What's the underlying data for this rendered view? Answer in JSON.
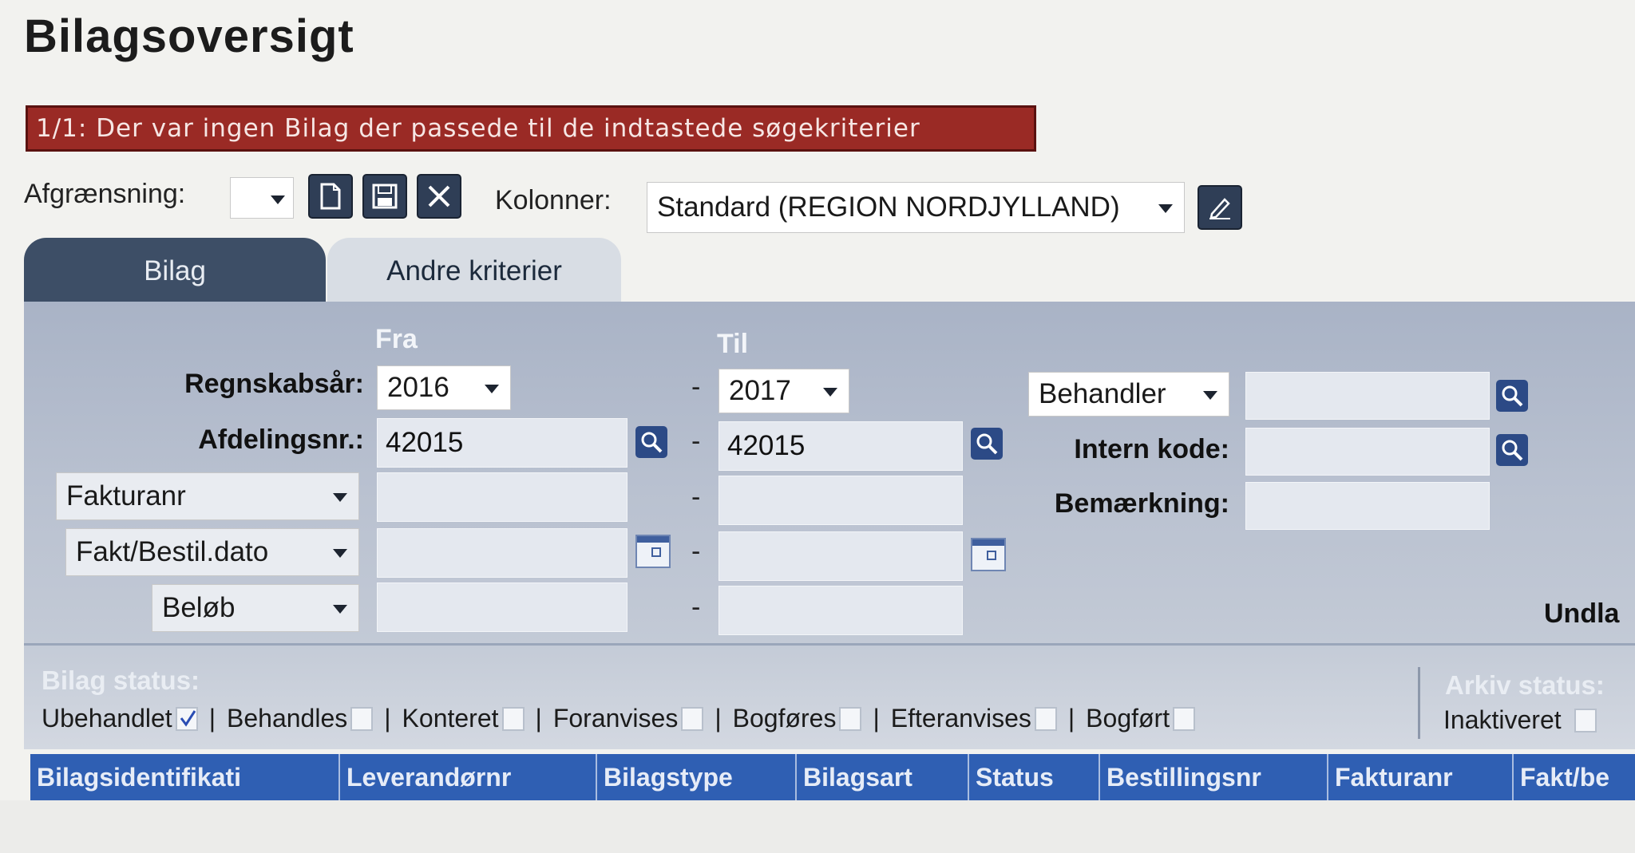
{
  "page": {
    "title": "Bilagsoversigt"
  },
  "error_message": "1/1: Der var ingen Bilag der passede til de indtastede søgekriterier",
  "toolbar": {
    "afgraensning_label": "Afgrænsning:",
    "afgraensning_value": "",
    "kolonner_label": "Kolonner:",
    "kolonner_value": "Standard (REGION NORDJYLLAND)"
  },
  "tabs": [
    {
      "label": "Bilag",
      "active": true
    },
    {
      "label": "Andre kriterier",
      "active": false
    }
  ],
  "search": {
    "fra_label": "Fra",
    "til_label": "Til",
    "dash": "-",
    "rows": [
      {
        "label": "Regnskabsår:",
        "fra": "2016",
        "til": "2017"
      },
      {
        "label": "Afdelingsnr.:",
        "fra": "42015",
        "til": "42015"
      },
      {
        "label": "Fakturanr",
        "fra": "",
        "til": ""
      },
      {
        "label": "Fakt/Bestil.dato",
        "fra": "",
        "til": ""
      },
      {
        "label": "Beløb",
        "fra": "",
        "til": ""
      }
    ],
    "right": {
      "behandler_label": "Behandler",
      "behandler_value": "",
      "intern_kode_label": "Intern kode:",
      "intern_kode_value": "",
      "bemaerkning_label": "Bemærkning:",
      "bemaerkning_value": "",
      "undla_label": "Undla"
    }
  },
  "bilag_status": {
    "title": "Bilag status:",
    "items": [
      {
        "label": "Ubehandlet",
        "checked": true
      },
      {
        "label": "Behandles",
        "checked": false
      },
      {
        "label": "Konteret",
        "checked": false
      },
      {
        "label": "Foranvises",
        "checked": false
      },
      {
        "label": "Bogføres",
        "checked": false
      },
      {
        "label": "Efteranvises",
        "checked": false
      },
      {
        "label": "Bogført",
        "checked": false
      }
    ]
  },
  "arkiv_status": {
    "title": "Arkiv status:",
    "items": [
      {
        "label": "Inaktiveret",
        "checked": false
      }
    ]
  },
  "grid": {
    "columns": [
      "Bilagsidentifikati",
      "Leverandørnr",
      "Bilagstype",
      "Bilagsart",
      "Status",
      "Bestillingsnr",
      "Fakturanr",
      "Fakt/be"
    ]
  },
  "colors": {
    "error_bg": "#9a2a25",
    "tab_active": "#3d4e66",
    "grid_header": "#2f5fb3",
    "icon_button": "#2f3e56"
  }
}
